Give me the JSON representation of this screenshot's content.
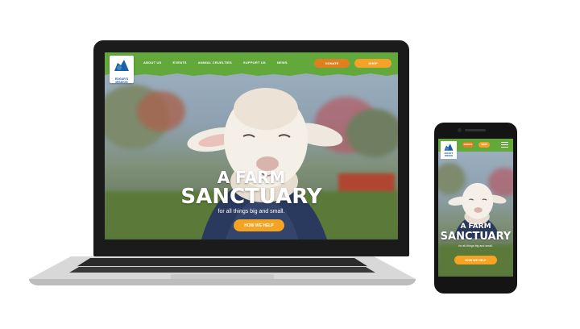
{
  "colors": {
    "brand_green": "#62a83a",
    "donate_orange": "#e07f1d",
    "shop_orange": "#f4a22a",
    "cta_orange": "#f4a322",
    "logo_blue": "#1d5fa3"
  },
  "site": {
    "logo_text": "EDGAR'S MISSION",
    "nav": [
      "ABOUT US",
      "EVENTS",
      "ANIMAL CRUELTIES",
      "SUPPORT US",
      "NEWS"
    ],
    "donate_label": "DONATE",
    "shop_label": "SHOP",
    "hero_title_line1": "A FARM",
    "hero_title_line2": "SANCTUARY",
    "hero_subtitle": "for all things big and small.",
    "cta_label": "HOW WE HELP"
  },
  "icons": {
    "logo": "sanctuary-logo-icon",
    "menu": "hamburger-menu-icon"
  }
}
